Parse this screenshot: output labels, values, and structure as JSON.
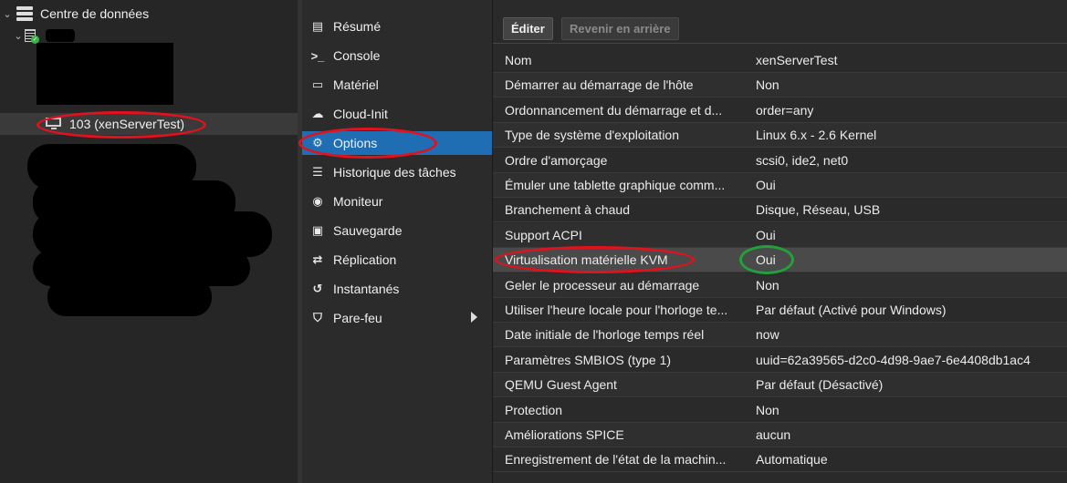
{
  "tree": {
    "datacenter_label": "Centre de données",
    "vm_label": "103 (xenServerTest)"
  },
  "nav": {
    "items": [
      {
        "label": "Résumé",
        "icon": "document-icon",
        "glyph": "▤"
      },
      {
        "label": "Console",
        "icon": "terminal-icon",
        "glyph": ">_"
      },
      {
        "label": "Matériel",
        "icon": "monitor-icon",
        "glyph": "▭"
      },
      {
        "label": "Cloud-Init",
        "icon": "cloud-icon",
        "glyph": "☁"
      },
      {
        "label": "Options",
        "icon": "gear-icon",
        "glyph": "⚙"
      },
      {
        "label": "Historique des tâches",
        "icon": "list-icon",
        "glyph": "☰"
      },
      {
        "label": "Moniteur",
        "icon": "eye-icon",
        "glyph": "◉"
      },
      {
        "label": "Sauvegarde",
        "icon": "floppy-icon",
        "glyph": "▣"
      },
      {
        "label": "Réplication",
        "icon": "retweet-icon",
        "glyph": "⇄"
      },
      {
        "label": "Instantanés",
        "icon": "history-icon",
        "glyph": "↺"
      },
      {
        "label": "Pare-feu",
        "icon": "shield-icon",
        "glyph": "⛉"
      }
    ],
    "active_index": 4
  },
  "toolbar": {
    "edit_label": "Éditer",
    "revert_label": "Revenir en arrière"
  },
  "options": [
    {
      "key": "Nom",
      "value": "xenServerTest"
    },
    {
      "key": "Démarrer au démarrage de l'hôte",
      "value": "Non"
    },
    {
      "key": "Ordonnancement du démarrage et d...",
      "value": "order=any"
    },
    {
      "key": "Type de système d'exploitation",
      "value": "Linux 6.x - 2.6 Kernel"
    },
    {
      "key": "Ordre d'amorçage",
      "value": "scsi0, ide2, net0"
    },
    {
      "key": "Émuler une tablette graphique comm...",
      "value": "Oui"
    },
    {
      "key": "Branchement à chaud",
      "value": "Disque, Réseau, USB"
    },
    {
      "key": "Support ACPI",
      "value": "Oui"
    },
    {
      "key": "Virtualisation matérielle KVM",
      "value": "Oui"
    },
    {
      "key": "Geler le processeur au démarrage",
      "value": "Non"
    },
    {
      "key": "Utiliser l'heure locale pour l'horloge te...",
      "value": "Par défaut (Activé pour Windows)"
    },
    {
      "key": "Date initiale de l'horloge temps réel",
      "value": "now"
    },
    {
      "key": "Paramètres SMBIOS (type 1)",
      "value": "uuid=62a39565-d2c0-4d98-9ae7-6e4408db1ac4"
    },
    {
      "key": "QEMU Guest Agent",
      "value": "Par défaut (Désactivé)"
    },
    {
      "key": "Protection",
      "value": "Non"
    },
    {
      "key": "Améliorations SPICE",
      "value": "aucun"
    },
    {
      "key": "Enregistrement de l'état de la machin...",
      "value": "Automatique"
    }
  ],
  "colors": {
    "accent": "#1f6eb3",
    "annotation_red": "#e3111d",
    "annotation_green": "#22a03a",
    "status_ok": "#38b449"
  }
}
